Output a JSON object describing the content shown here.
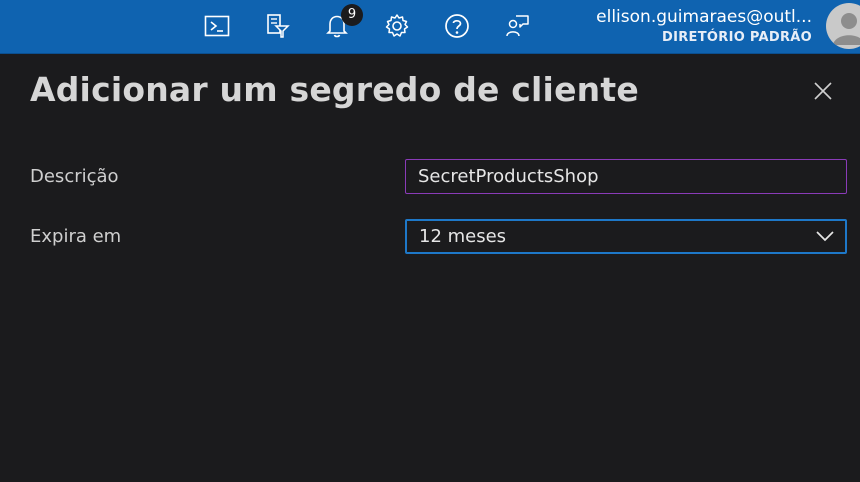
{
  "topbar": {
    "icons": [
      {
        "name": "cloud-shell-icon"
      },
      {
        "name": "directory-filter-icon"
      },
      {
        "name": "notifications-icon",
        "badge": "9"
      },
      {
        "name": "settings-gear-icon"
      },
      {
        "name": "help-icon"
      },
      {
        "name": "feedback-icon"
      }
    ],
    "account": {
      "email": "ellison.guimaraes@outl...",
      "directory": "DIRETÓRIO PADRÃO"
    },
    "colors": {
      "bar": "#0f63b0"
    }
  },
  "panel": {
    "title": "Adicionar um segredo de cliente",
    "close_icon": "close-icon",
    "fields": {
      "description": {
        "label": "Descrição",
        "value": "SecretProductsShop"
      },
      "expires": {
        "label": "Expira em",
        "selected": "12 meses"
      }
    }
  },
  "colors": {
    "background": "#1b1b1d",
    "focus_border": "#8a3bb8",
    "select_border": "#1e78c8"
  }
}
